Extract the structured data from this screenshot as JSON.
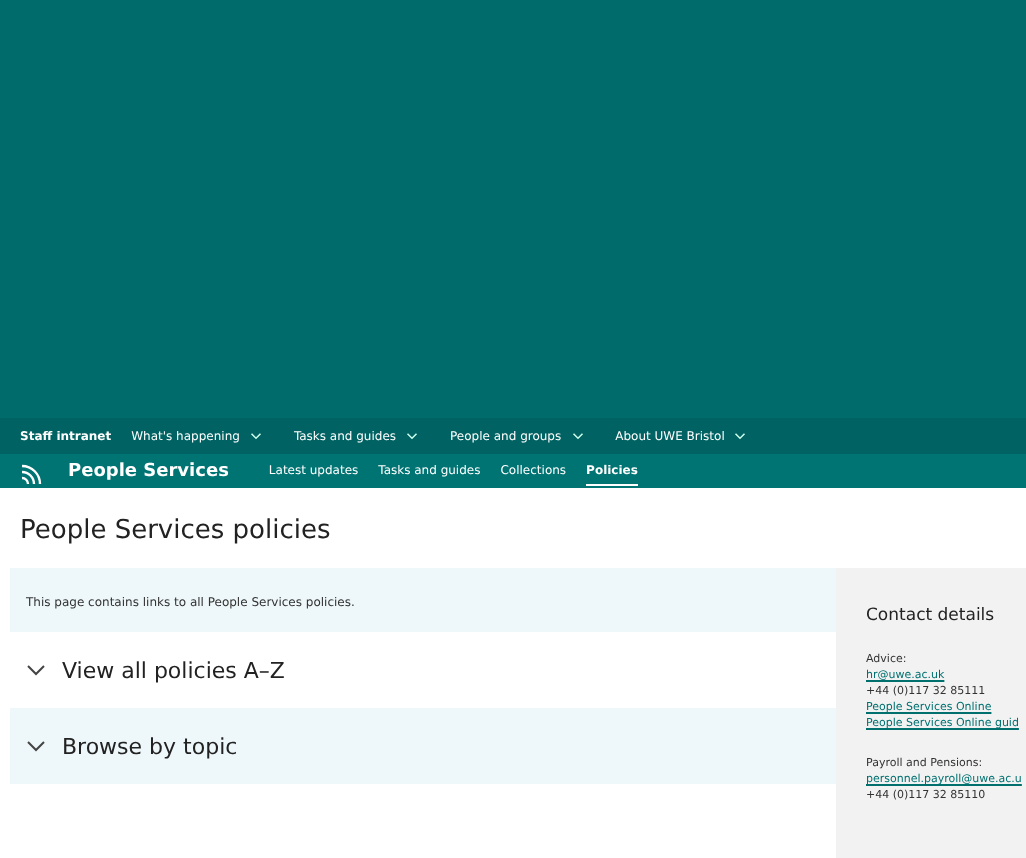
{
  "global_nav": {
    "home": "Staff intranet",
    "items": [
      {
        "label": "What's happening",
        "has_menu": true
      },
      {
        "label": "Tasks and guides",
        "has_menu": true
      },
      {
        "label": "People and groups",
        "has_menu": true
      },
      {
        "label": "About UWE Bristol",
        "has_menu": true
      }
    ]
  },
  "site_nav": {
    "title": "People Services",
    "items": [
      {
        "label": "Latest updates",
        "selected": false
      },
      {
        "label": "Tasks and guides",
        "selected": false
      },
      {
        "label": "Collections",
        "selected": false
      },
      {
        "label": "Policies",
        "selected": true
      }
    ]
  },
  "page_title": "People Services policies",
  "intro": "This page contains links to all People Services policies.",
  "accordion": [
    {
      "label": "View all policies A–Z",
      "expanded": false
    },
    {
      "label": "Browse by topic",
      "expanded": false
    }
  ],
  "contact": {
    "title": "Contact details",
    "groups": [
      {
        "lines": [
          {
            "kind": "text",
            "text": "Advice:"
          },
          {
            "kind": "link",
            "text": "hr@uwe.ac.uk"
          },
          {
            "kind": "text",
            "text": "+44 (0)117 32 85111"
          },
          {
            "kind": "link",
            "text": "People Services Online"
          },
          {
            "kind": "link",
            "text": "People Services Online guid"
          }
        ]
      },
      {
        "lines": [
          {
            "kind": "text",
            "text": "Payroll and Pensions:"
          },
          {
            "kind": "link",
            "text": "personnel.payroll@uwe.ac.u"
          },
          {
            "kind": "text",
            "text": "+44 (0)117 32 85110"
          }
        ]
      }
    ]
  }
}
